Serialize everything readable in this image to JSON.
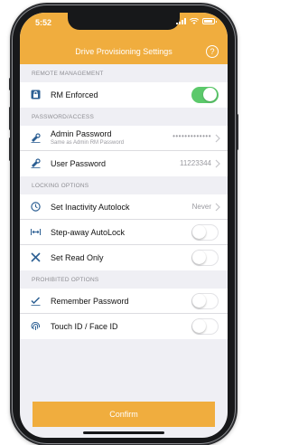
{
  "status_bar": {
    "time": "5:52"
  },
  "header": {
    "title": "Drive Provisioning Settings",
    "help_glyph": "?"
  },
  "sections": {
    "remote": {
      "label": "REMOTE MANAGEMENT",
      "rm_enforced": {
        "label": "RM Enforced",
        "on": true
      }
    },
    "password": {
      "label": "PASSWORD/ACCESS",
      "admin": {
        "label": "Admin Password",
        "sublabel": "Same as Admin RM Password",
        "value": "•••••••••••••"
      },
      "user": {
        "label": "User Password",
        "value": "11223344"
      }
    },
    "locking": {
      "label": "LOCKING OPTIONS",
      "autolock": {
        "label": "Set Inactivity Autolock",
        "value": "Never"
      },
      "stepaway": {
        "label": "Step-away AutoLock",
        "on": false
      },
      "readonly": {
        "label": "Set Read Only",
        "on": false
      }
    },
    "prohibited": {
      "label": "PROHIBITED OPTIONS",
      "remember": {
        "label": "Remember Password",
        "on": false
      },
      "touchid": {
        "label": "Touch ID / Face ID",
        "on": false
      }
    }
  },
  "confirm": {
    "label": "Confirm"
  },
  "colors": {
    "accent": "#f0ad3e",
    "toggle_on": "#5cc96b",
    "icon_blue": "#2c5f93"
  }
}
